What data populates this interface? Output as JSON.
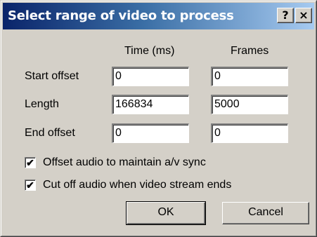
{
  "window": {
    "title": "Select range of video to process",
    "help_label": "?",
    "close_label": "×"
  },
  "columns": {
    "time": "Time (ms)",
    "frames": "Frames"
  },
  "rows": [
    {
      "label": "Start offset",
      "time": "0",
      "frames": "0"
    },
    {
      "label": "Length",
      "time": "166834",
      "frames": "5000"
    },
    {
      "label": "End offset",
      "time": "0",
      "frames": "0"
    }
  ],
  "options": [
    {
      "label": "Offset audio to maintain a/v sync",
      "checked": true,
      "mark": "✔"
    },
    {
      "label": "Cut off audio when video stream ends",
      "checked": true,
      "mark": "✔"
    }
  ],
  "buttons": {
    "ok": "OK",
    "cancel": "Cancel"
  }
}
